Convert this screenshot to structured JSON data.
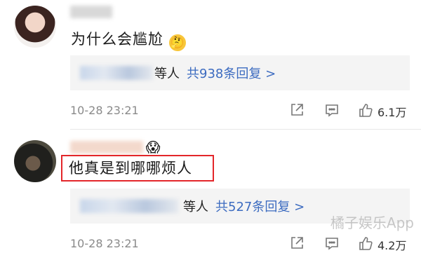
{
  "comments": [
    {
      "text": "为什么会尴尬",
      "emoji": "🤔",
      "reply_suffix": "等人",
      "reply_link": "共938条回复 >",
      "timestamp": "10-28 23:21",
      "likes": "6.1万"
    },
    {
      "text": "他真是到哪哪烦人",
      "badge": "😱",
      "reply_suffix": "等人",
      "reply_link": "共527条回复 >",
      "timestamp": "10-28 23:21",
      "likes": "4.2万"
    }
  ],
  "watermark": "橘子娱乐App",
  "colors": {
    "link": "#3c6bc0",
    "highlight": "#e3262a",
    "reply_bg": "#f4f4f4"
  },
  "icons": [
    "share-icon",
    "comment-icon",
    "thumbs-up-icon"
  ]
}
